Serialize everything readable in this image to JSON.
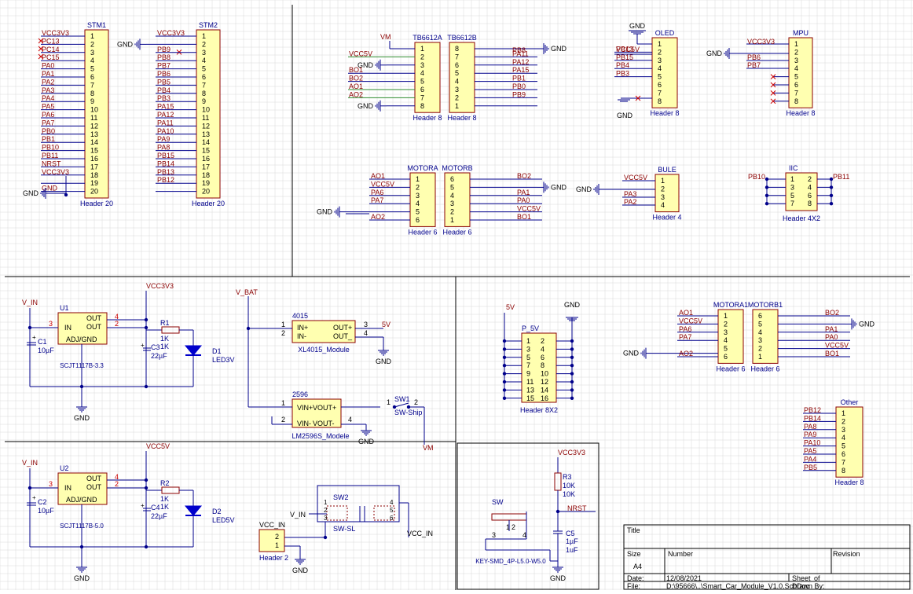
{
  "colors": {
    "wire": "#00008B",
    "body": "#FFFFB0",
    "body_border": "#8B0000",
    "net": "#8B0000",
    "ref": "#00008B",
    "pin": "#000000",
    "redpin": "#CC0000",
    "grid": "#D8D8D8",
    "led": "#0000CC"
  },
  "stm1": {
    "ref": "STM1",
    "part": "Header 20",
    "pins": [
      "1",
      "2",
      "3",
      "4",
      "5",
      "6",
      "7",
      "8",
      "9",
      "10",
      "11",
      "12",
      "13",
      "14",
      "15",
      "16",
      "17",
      "18",
      "19",
      "20"
    ],
    "nets": [
      "VCC3V3",
      "PC13",
      "PC14",
      "PC15",
      "PA0",
      "PA1",
      "PA2",
      "PA3",
      "PA4",
      "PA5",
      "PA6",
      "PA7",
      "PB0",
      "PB1",
      "PB10",
      "PB11",
      "NRST",
      "VCC3V3",
      "",
      "GND"
    ]
  },
  "stm2": {
    "ref": "STM2",
    "part": "Header 20",
    "pins": [
      "1",
      "2",
      "3",
      "4",
      "5",
      "6",
      "7",
      "8",
      "9",
      "10",
      "11",
      "12",
      "13",
      "14",
      "15",
      "16",
      "17",
      "18",
      "19",
      "20"
    ],
    "nets": [
      "VCC3V3",
      "GND",
      "PB9",
      "PB8",
      "PB7",
      "PB6",
      "PB5",
      "PB4",
      "PB3",
      "PA15",
      "PA12",
      "PA11",
      "PA10",
      "PA9",
      "PA8",
      "PB15",
      "PB14",
      "PB13",
      "PB12",
      ""
    ]
  },
  "tb6612a": {
    "ref": "TB6612A",
    "part": "Header 8",
    "pins": [
      "1",
      "2",
      "3",
      "4",
      "5",
      "6",
      "7",
      "8"
    ],
    "nets": [
      "VM",
      "",
      "GND",
      "BO1",
      "BO2",
      "AO1",
      "AO2",
      "GND"
    ],
    "left_labels": [
      "VM",
      "VCC5V",
      "GND",
      "BO1",
      "BO2",
      "AO1",
      "AO2",
      "GND"
    ]
  },
  "tb6612b": {
    "ref": "TB6612B",
    "part": "Header 8",
    "pins": [
      "8",
      "7",
      "6",
      "5",
      "4",
      "3",
      "2",
      "1"
    ],
    "nets": [
      "PB8",
      "PA11",
      "PA12",
      "PA15",
      "PB1",
      "PB0",
      "PB9"
    ],
    "gnd": "GND"
  },
  "oled": {
    "ref": "OLED",
    "part": "Header 8",
    "pins": [
      "1",
      "2",
      "3",
      "4",
      "5",
      "6",
      "7",
      "8"
    ],
    "nets": [
      "VCC5V",
      "PB13",
      "PB15",
      "PB4",
      "PB3"
    ],
    "top": "GND",
    "bottom": "GND"
  },
  "mpu": {
    "ref": "MPU",
    "part": "Header 8",
    "pins": [
      "1",
      "2",
      "3",
      "4",
      "5",
      "6",
      "7",
      "8"
    ],
    "nets": [
      "VCC3V3",
      "GND",
      "PB6",
      "PB7"
    ]
  },
  "motora": {
    "ref": "MOTORA",
    "part": "Header 6",
    "pins": [
      "1",
      "2",
      "3",
      "4",
      "5",
      "6"
    ],
    "nets": [
      "AO1",
      "VCC5V",
      "PA6",
      "PA7",
      "GND",
      "AO2"
    ]
  },
  "motorb": {
    "ref": "MOTORB",
    "part": "Header 6",
    "pins": [
      "6",
      "5",
      "4",
      "3",
      "2",
      "1"
    ],
    "nets": [
      "BO2",
      "GND",
      "PA1",
      "PA0",
      "VCC5V",
      "BO1"
    ]
  },
  "bule": {
    "ref": "BULE",
    "part": "Header 4",
    "pins": [
      "1",
      "2",
      "3",
      "4"
    ],
    "nets": [
      "VCC5V",
      "GND",
      "PA3",
      "PA2"
    ]
  },
  "iic": {
    "ref": "IIC",
    "part": "Header 4X2",
    "pins_left": [
      "1",
      "3",
      "5",
      "7"
    ],
    "pins_right": [
      "2",
      "4",
      "6",
      "8"
    ],
    "net_left": "PB10",
    "net_right": "PB11"
  },
  "u1": {
    "ref": "U1",
    "part": "SCJT1117B-3.3",
    "in": "IN",
    "out": "OUT",
    "adj": "ADJ/GND",
    "pin_in": "3",
    "pin_out1": "4",
    "pin_out2": "2",
    "vin": "V_IN",
    "vout": "VCC3V3",
    "c1": "C1",
    "c1v": "10µF",
    "c3": "C3",
    "c3v": "22µF",
    "r1": "R1",
    "r1v1": "1K",
    "r1v2": "1K",
    "d1": "D1",
    "d1v": "LED3V",
    "gnd": "GND"
  },
  "u2": {
    "ref": "U2",
    "part": "SCJT1117B-5.0",
    "in": "IN",
    "out": "OUT",
    "adj": "ADJ/GND",
    "pin_in": "3",
    "pin_out1": "4",
    "pin_out2": "2",
    "vin": "V_IN",
    "vout": "VCC5V",
    "c2": "C2",
    "c2v": "10µF",
    "c4": "C4",
    "c4v": "22µF",
    "r2": "R2",
    "r2v1": "1K",
    "r2v2": "1K",
    "d2": "D2",
    "d2v": "LED5V",
    "gnd": "GND"
  },
  "m4015": {
    "ref": "4015",
    "part": "XL4015_Module",
    "pins_left": [
      "IN+",
      "IN-"
    ],
    "pins_right": [
      "OUT+",
      "OUT_"
    ],
    "pn": [
      "1",
      "2",
      "3",
      "4"
    ],
    "vin": "V_BAT",
    "out": "5V",
    "gnd": "GND"
  },
  "m2596": {
    "ref": "2596",
    "part": "LM2596S_Modele",
    "pins_left": [
      "VIN+",
      "VIN-"
    ],
    "pins_right": [
      "VOUT+",
      "VOUT-"
    ],
    "pn": [
      "1",
      "2",
      "3",
      "4"
    ],
    "gnd": "GND"
  },
  "sw1": {
    "ref": "SW1",
    "part": "SW-Ship",
    "p1": "1",
    "p2": "2",
    "out": "VM"
  },
  "sw2": {
    "ref": "SW2",
    "part": "SW-SL",
    "pins": [
      "1",
      "2",
      "3",
      "4",
      "5",
      "6"
    ],
    "vin": "V_IN",
    "vcc": "VCC_IN"
  },
  "vccin": {
    "ref": "VCC_IN",
    "part": "Header 2",
    "pins": [
      "2",
      "1"
    ],
    "gnd": "GND"
  },
  "p5v": {
    "ref": "P_5V",
    "part": "Header 8X2",
    "net": "5V",
    "gnd": "GND",
    "pins_left": [
      "1",
      "3",
      "5",
      "7",
      "9",
      "11",
      "13",
      "15"
    ],
    "pins_right": [
      "2",
      "4",
      "6",
      "8",
      "10",
      "12",
      "14",
      "16"
    ]
  },
  "motora1": {
    "ref": "MOTORA1",
    "part": "Header 6",
    "pins": [
      "1",
      "2",
      "3",
      "4",
      "5",
      "6"
    ],
    "nets": [
      "AO1",
      "VCC5V",
      "PA6",
      "PA7",
      "GND",
      "AO2"
    ]
  },
  "motorb1": {
    "ref": "MOTORB1",
    "part": "Header 6",
    "pins": [
      "6",
      "5",
      "4",
      "3",
      "2",
      "1"
    ],
    "nets": [
      "BO2",
      "GND",
      "PA1",
      "PA0",
      "VCC5V",
      "BO1"
    ]
  },
  "other": {
    "ref": "Other",
    "part": "Header 8",
    "pins": [
      "1",
      "2",
      "3",
      "4",
      "5",
      "6",
      "7",
      "8"
    ],
    "nets": [
      "PB12",
      "PB14",
      "PA8",
      "PA9",
      "PA10",
      "PA5",
      "PA4",
      "PB5"
    ]
  },
  "reset": {
    "sw": "SW",
    "part": "KEY-SMD_4P-L5.0-W5.0",
    "vcc": "VCC3V3",
    "r3": "R3",
    "r3v1": "10K",
    "r3v2": "10K",
    "nrst": "NRST",
    "c5": "C5",
    "c5v1": "1µF",
    "c5v2": "1uF",
    "gnd": "GND",
    "pins": [
      "1",
      "2",
      "3",
      "4"
    ]
  },
  "titleblock": {
    "title": "Title",
    "size_label": "Size",
    "size": "A4",
    "number_label": "Number",
    "revision_label": "Revision",
    "date_label": "Date:",
    "date": "12/08/2021",
    "sheet_label": "Sheet",
    "of_label": "of",
    "file_label": "File:",
    "file": "D:\\95666\\..\\Smart_Car_Module_V1.0.SchDoc",
    "drawn_label": "Drawn By:"
  }
}
